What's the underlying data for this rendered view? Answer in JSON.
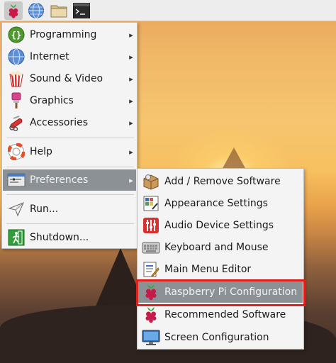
{
  "taskbar": {
    "icons": [
      "raspberry-menu-icon",
      "web-browser-icon",
      "file-manager-icon",
      "terminal-icon"
    ]
  },
  "main_menu": {
    "items": [
      {
        "label": "Programming",
        "icon": "programming-icon",
        "has_submenu": true
      },
      {
        "label": "Internet",
        "icon": "internet-icon",
        "has_submenu": true
      },
      {
        "label": "Sound & Video",
        "icon": "sound-video-icon",
        "has_submenu": true
      },
      {
        "label": "Graphics",
        "icon": "graphics-icon",
        "has_submenu": true
      },
      {
        "label": "Accessories",
        "icon": "accessories-icon",
        "has_submenu": true
      },
      {
        "label": "Help",
        "icon": "help-icon",
        "has_submenu": true
      },
      {
        "label": "Preferences",
        "icon": "preferences-icon",
        "has_submenu": true,
        "selected": true
      },
      {
        "label": "Run...",
        "icon": "run-icon",
        "has_submenu": false
      },
      {
        "label": "Shutdown...",
        "icon": "shutdown-icon",
        "has_submenu": false
      }
    ]
  },
  "preferences_menu": {
    "items": [
      {
        "label": "Add / Remove Software",
        "icon": "package-icon"
      },
      {
        "label": "Appearance Settings",
        "icon": "appearance-icon"
      },
      {
        "label": "Audio Device Settings",
        "icon": "audio-mixer-icon"
      },
      {
        "label": "Keyboard and Mouse",
        "icon": "keyboard-icon"
      },
      {
        "label": "Main Menu Editor",
        "icon": "menu-editor-icon"
      },
      {
        "label": "Raspberry Pi Configuration",
        "icon": "raspberry-icon",
        "hovered": true,
        "annotated": true
      },
      {
        "label": "Recommended Software",
        "icon": "raspberry-icon"
      },
      {
        "label": "Screen Configuration",
        "icon": "monitor-icon"
      }
    ]
  },
  "colors": {
    "menu_bg": "#f4f4f4",
    "selection": "#8c9196",
    "annotation": "#e0201b"
  }
}
